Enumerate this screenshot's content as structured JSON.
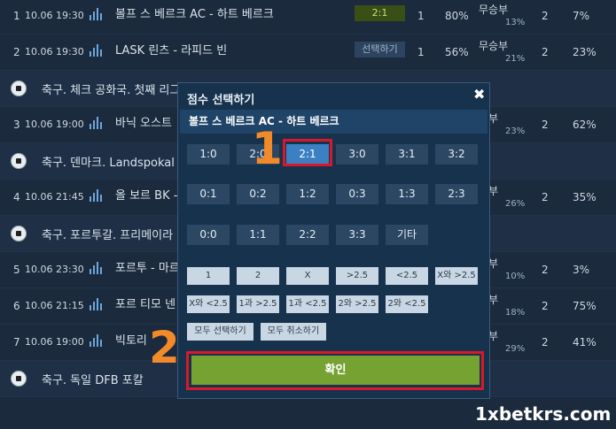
{
  "rows": [
    {
      "num": "1",
      "time": "10.06 19:30",
      "match": "볼프 스 베르크 AC - 하트 베르크",
      "sel": "2:1",
      "c1": "1",
      "c2": "80%",
      "mu": "무승부",
      "mup": "13%",
      "c4": "2",
      "c5": "7%"
    },
    {
      "num": "2",
      "time": "10.06 19:30",
      "match": "LASK 린츠 - 라피드 빈",
      "sel": "선택하기",
      "c1": "1",
      "c2": "56%",
      "mu": "무승부",
      "mup": "21%",
      "c4": "2",
      "c5": "23%"
    },
    {
      "league": "축구. 체크 공화국. 첫째 리그"
    },
    {
      "num": "3",
      "time": "10.06 19:00",
      "match": "바닉 오스트",
      "sel": "",
      "c1": "",
      "c2": "",
      "mu": "승부",
      "mup": "23%",
      "c4": "2",
      "c5": "62%"
    },
    {
      "league": "축구. 덴마크. Landspokal"
    },
    {
      "num": "4",
      "time": "10.06 21:45",
      "match": "올 보르 BK -",
      "sel": "",
      "c1": "",
      "c2": "",
      "mu": "승부",
      "mup": "26%",
      "c4": "2",
      "c5": "35%"
    },
    {
      "league": "축구. 포르투갈. 프리메이라"
    },
    {
      "num": "5",
      "time": "10.06 23:30",
      "match": "포르투 - 마르",
      "sel": "",
      "c1": "",
      "c2": "",
      "mu": "승부",
      "mup": "10%",
      "c4": "2",
      "c5": "3%"
    },
    {
      "num": "6",
      "time": "10.06 21:15",
      "match": "포르 티모 넨",
      "sel": "",
      "c1": "",
      "c2": "",
      "mu": "승부",
      "mup": "18%",
      "c4": "2",
      "c5": "75%"
    },
    {
      "num": "7",
      "time": "10.06 19:00",
      "match": "빅토리",
      "sel": "",
      "c1": "",
      "c2": "",
      "mu": "승부",
      "mup": "29%",
      "c4": "2",
      "c5": "41%"
    },
    {
      "league": "축구. 독일 DFB 포칼"
    }
  ],
  "modal": {
    "title": "점수 선택하기",
    "close": "✖",
    "match": "볼프 스 베르크 AC - 하트 베르크",
    "scores_row1": [
      "1:0",
      "2:0",
      "2:1",
      "3:0",
      "3:1",
      "3:2"
    ],
    "scores_row2": [
      "0:1",
      "0:2",
      "1:2",
      "0:3",
      "1:3",
      "2:3"
    ],
    "scores_row3": [
      "0:0",
      "1:1",
      "2:2",
      "3:3",
      "기타"
    ],
    "selected_score": "2:1",
    "opts_row1": [
      "1",
      "2",
      "X",
      ">2.5",
      "<2.5",
      "X와 >2.5"
    ],
    "opts_row2": [
      "X와 <2.5",
      "1과 >2.5",
      "1과 <2.5",
      "2와 >2.5",
      "2와 <2.5"
    ],
    "select_all": "모두 선택하기",
    "cancel_all": "모두 취소하기",
    "confirm": "확인"
  },
  "callouts": {
    "one": "1",
    "two": "2"
  },
  "watermark": "1xbetkrs.com",
  "colors": {
    "callout": "#f28a2a",
    "highlight": "#d9182a",
    "confirm": "#76a231",
    "selected": "#3b80c2"
  }
}
